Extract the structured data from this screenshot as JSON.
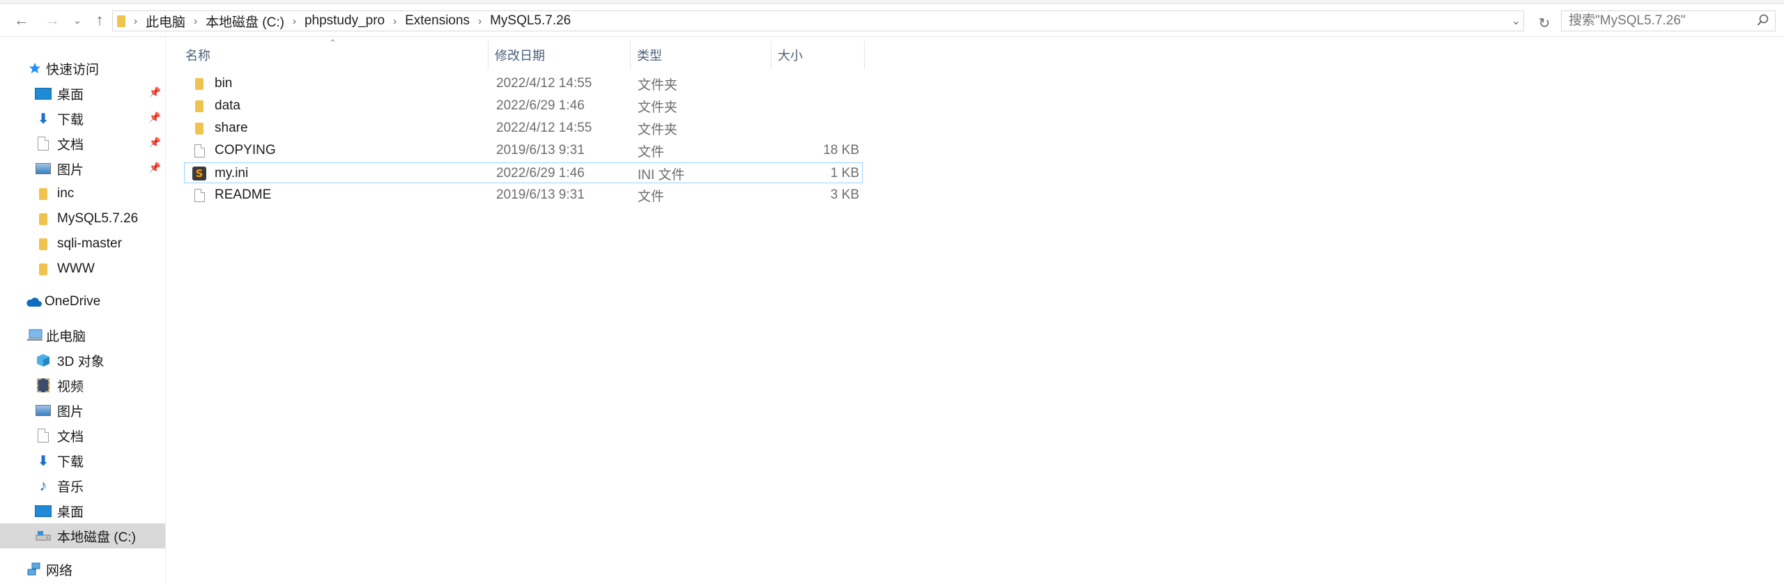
{
  "address": {
    "crumbs": [
      "此电脑",
      "本地磁盘 (C:)",
      "phpstudy_pro",
      "Extensions",
      "MySQL5.7.26"
    ]
  },
  "search": {
    "placeholder": "搜索\"MySQL5.7.26\""
  },
  "sidebar": {
    "quick_access": "快速访问",
    "quick_items": [
      {
        "label": "桌面",
        "icon": "desktop-icon",
        "pinned": true
      },
      {
        "label": "下载",
        "icon": "download-icon",
        "pinned": true
      },
      {
        "label": "文档",
        "icon": "document-icon",
        "pinned": true
      },
      {
        "label": "图片",
        "icon": "picture-icon",
        "pinned": true
      },
      {
        "label": "inc",
        "icon": "folder-icon",
        "pinned": false
      },
      {
        "label": "MySQL5.7.26",
        "icon": "folder-icon",
        "pinned": false
      },
      {
        "label": "sqli-master",
        "icon": "folder-icon",
        "pinned": false
      },
      {
        "label": "WWW",
        "icon": "folder-icon",
        "pinned": false
      }
    ],
    "onedrive": "OneDrive",
    "this_pc": "此电脑",
    "pc_items": [
      {
        "label": "3D 对象",
        "icon": "3d-objects-icon"
      },
      {
        "label": "视频",
        "icon": "video-icon"
      },
      {
        "label": "图片",
        "icon": "picture-icon"
      },
      {
        "label": "文档",
        "icon": "document-icon"
      },
      {
        "label": "下载",
        "icon": "download-icon"
      },
      {
        "label": "音乐",
        "icon": "music-icon"
      },
      {
        "label": "桌面",
        "icon": "desktop-icon"
      },
      {
        "label": "本地磁盘 (C:)",
        "icon": "drive-icon",
        "selected": true
      }
    ],
    "network": "网络"
  },
  "columns": {
    "name": "名称",
    "date": "修改日期",
    "type": "类型",
    "size": "大小"
  },
  "files": [
    {
      "name": "bin",
      "date": "2022/4/12 14:55",
      "type": "文件夹",
      "size": "",
      "icon": "folder-icon"
    },
    {
      "name": "data",
      "date": "2022/6/29 1:46",
      "type": "文件夹",
      "size": "",
      "icon": "folder-icon"
    },
    {
      "name": "share",
      "date": "2022/4/12 14:55",
      "type": "文件夹",
      "size": "",
      "icon": "folder-icon"
    },
    {
      "name": "COPYING",
      "date": "2019/6/13 9:31",
      "type": "文件",
      "size": "18 KB",
      "icon": "file-icon"
    },
    {
      "name": "my.ini",
      "date": "2022/6/29 1:46",
      "type": "INI 文件",
      "size": "1 KB",
      "icon": "ini-file-icon",
      "selected": true
    },
    {
      "name": "README",
      "date": "2019/6/13 9:31",
      "type": "文件",
      "size": "3 KB",
      "icon": "file-icon"
    }
  ]
}
